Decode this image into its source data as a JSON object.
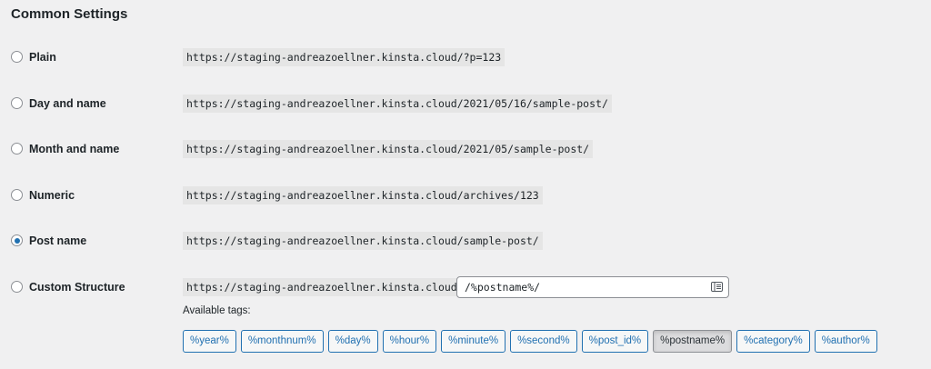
{
  "section_title": "Common Settings",
  "options": [
    {
      "label": "Plain",
      "url": "https://staging-andreazoellner.kinsta.cloud/?p=123",
      "checked": false
    },
    {
      "label": "Day and name",
      "url": "https://staging-andreazoellner.kinsta.cloud/2021/05/16/sample-post/",
      "checked": false
    },
    {
      "label": "Month and name",
      "url": "https://staging-andreazoellner.kinsta.cloud/2021/05/sample-post/",
      "checked": false
    },
    {
      "label": "Numeric",
      "url": "https://staging-andreazoellner.kinsta.cloud/archives/123",
      "checked": false
    },
    {
      "label": "Post name",
      "url": "https://staging-andreazoellner.kinsta.cloud/sample-post/",
      "checked": true
    },
    {
      "label": "Custom Structure",
      "url": "https://staging-andreazoellner.kinsta.cloud",
      "checked": false
    }
  ],
  "custom_structure_value": "/%postname%/",
  "available_tags_label": "Available tags:",
  "tags": [
    {
      "label": "%year%",
      "active": false
    },
    {
      "label": "%monthnum%",
      "active": false
    },
    {
      "label": "%day%",
      "active": false
    },
    {
      "label": "%hour%",
      "active": false
    },
    {
      "label": "%minute%",
      "active": false
    },
    {
      "label": "%second%",
      "active": false
    },
    {
      "label": "%post_id%",
      "active": false
    },
    {
      "label": "%postname%",
      "active": true
    },
    {
      "label": "%category%",
      "active": false
    },
    {
      "label": "%author%",
      "active": false
    }
  ],
  "colors": {
    "accent": "#2271b1",
    "background": "#f0f0f1",
    "code_background": "#e5e5e5",
    "text": "#1d2327"
  },
  "icons": {
    "input_icon": "form-field-icon"
  }
}
